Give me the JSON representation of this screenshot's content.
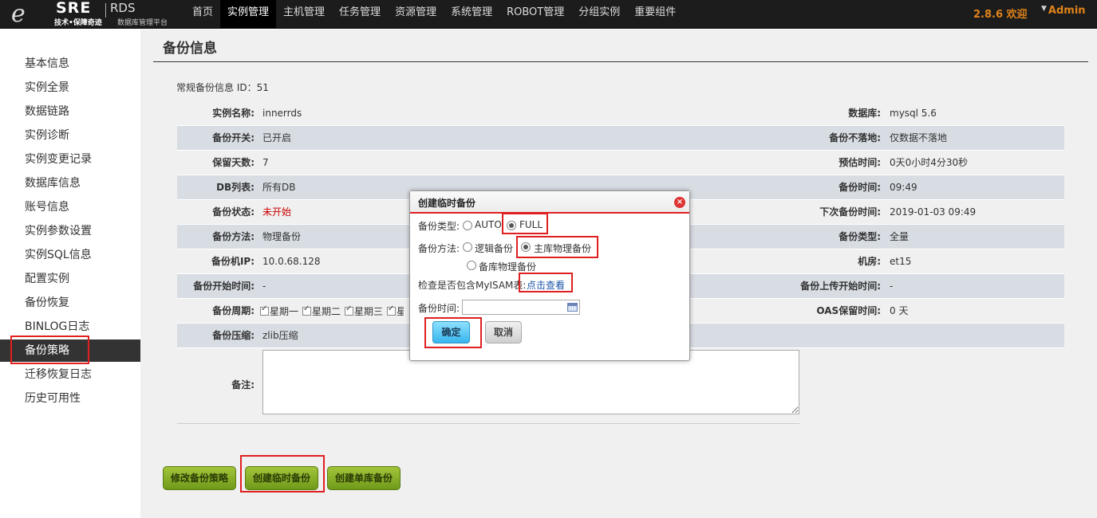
{
  "header": {
    "logo": {
      "mark": "e",
      "brand": "SRE",
      "product": "RDS",
      "slogan": "技术•保障奇迹",
      "platform": "数据库管理平台"
    },
    "nav": [
      "首页",
      "实例管理",
      "主机管理",
      "任务管理",
      "资源管理",
      "系统管理",
      "ROBOT管理",
      "分组实例",
      "重要组件"
    ],
    "active_nav": "实例管理",
    "version_welcome": "2.8.6 欢迎",
    "user": "Admin"
  },
  "sidebar": {
    "items": [
      "基本信息",
      "实例全景",
      "数据链路",
      "实例诊断",
      "实例变更记录",
      "数据库信息",
      "账号信息",
      "实例参数设置",
      "实例SQL信息",
      "配置实例",
      "备份恢复",
      "BINLOG日志",
      "备份策略",
      "迁移恢复日志",
      "历史可用性"
    ],
    "active": "备份策略"
  },
  "main": {
    "title": "备份信息",
    "backup_id_text": "常规备份信息 ID：51",
    "rows": [
      {
        "l_label": "实例名称:",
        "l_value": "innerrds",
        "r_label": "数据库:",
        "r_value": "mysql 5.6"
      },
      {
        "l_label": "备份开关:",
        "l_value": "已开启",
        "r_label": "备份不落地:",
        "r_value": "仅数据不落地"
      },
      {
        "l_label": "保留天数:",
        "l_value": "7",
        "r_label": "预估时间:",
        "r_value": "0天0小时4分30秒"
      },
      {
        "l_label": "DB列表:",
        "l_value": "所有DB",
        "r_label": "备份时间:",
        "r_value": "09:49"
      },
      {
        "l_label": "备份状态:",
        "l_value": "未开始",
        "r_label": "下次备份时间:",
        "r_value": "2019-01-03 09:49"
      },
      {
        "l_label": "备份方法:",
        "l_value": "物理备份",
        "r_label": "备份类型:",
        "r_value": "全量"
      },
      {
        "l_label": "备份机IP:",
        "l_value": "10.0.68.128",
        "r_label": "机房:",
        "r_value": "et15"
      },
      {
        "l_label": "备份开始时间:",
        "l_value": "-",
        "r_label": "备份上传开始时间:",
        "r_value": "-"
      },
      {
        "l_label": "备份周期:",
        "l_value": "",
        "r_label": "OAS保留时间:",
        "r_value": "0 天"
      },
      {
        "l_label": "备份压缩:",
        "l_value": "zlib压缩",
        "r_label": "",
        "r_value": ""
      }
    ],
    "weekdays": [
      "星期一",
      "星期二",
      "星期三",
      "星"
    ],
    "remark_label": "备注:",
    "buttons": [
      "修改备份策略",
      "创建临时备份",
      "创建单库备份"
    ]
  },
  "modal": {
    "title": "创建临时备份",
    "close": "×",
    "type_label": "备份类型:",
    "type_options": [
      "AUTO",
      "FULL"
    ],
    "type_selected": "FULL",
    "method_label": "备份方法:",
    "method_options": [
      "逻辑备份",
      "主库物理备份",
      "备库物理备份"
    ],
    "method_selected": "主库物理备份",
    "check_text": "检查是否包含MyISAM表:",
    "check_link": "点击查看",
    "time_label": "备份时间:",
    "time_value": "",
    "ok": "确定",
    "cancel": "取消"
  },
  "colors": {
    "highlight": "#e02020",
    "version": "#e0831a",
    "status_red": "#cc0000"
  }
}
